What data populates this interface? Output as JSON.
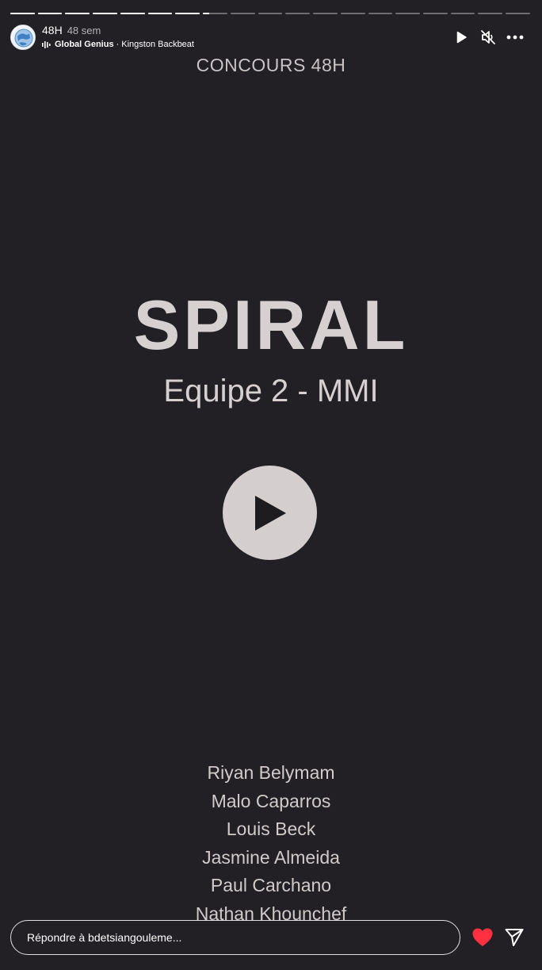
{
  "progress": {
    "segments": 19,
    "completed": 7,
    "current_fraction": 0.25
  },
  "header": {
    "username": "48H",
    "time": "48 sem",
    "music": {
      "artist": "Global Genius",
      "separator": "·",
      "track": "Kingston Backbeat"
    },
    "icons": [
      "play-icon",
      "mute-icon",
      "more-icon"
    ]
  },
  "story": {
    "kicker": "CONCOURS 48H",
    "title": "SPIRAL",
    "subtitle": "Equipe 2 - MMI",
    "credits": [
      "Riyan Belymam",
      "Malo Caparros",
      "Louis Beck",
      "Jasmine Almeida",
      "Paul Carchano",
      "Nathan Khounchef"
    ]
  },
  "reply": {
    "placeholder": "Répondre à bdetsiangouleme..."
  },
  "colors": {
    "background": "#222024",
    "like": "#ff3040",
    "text_light": "#d6d0d1"
  }
}
